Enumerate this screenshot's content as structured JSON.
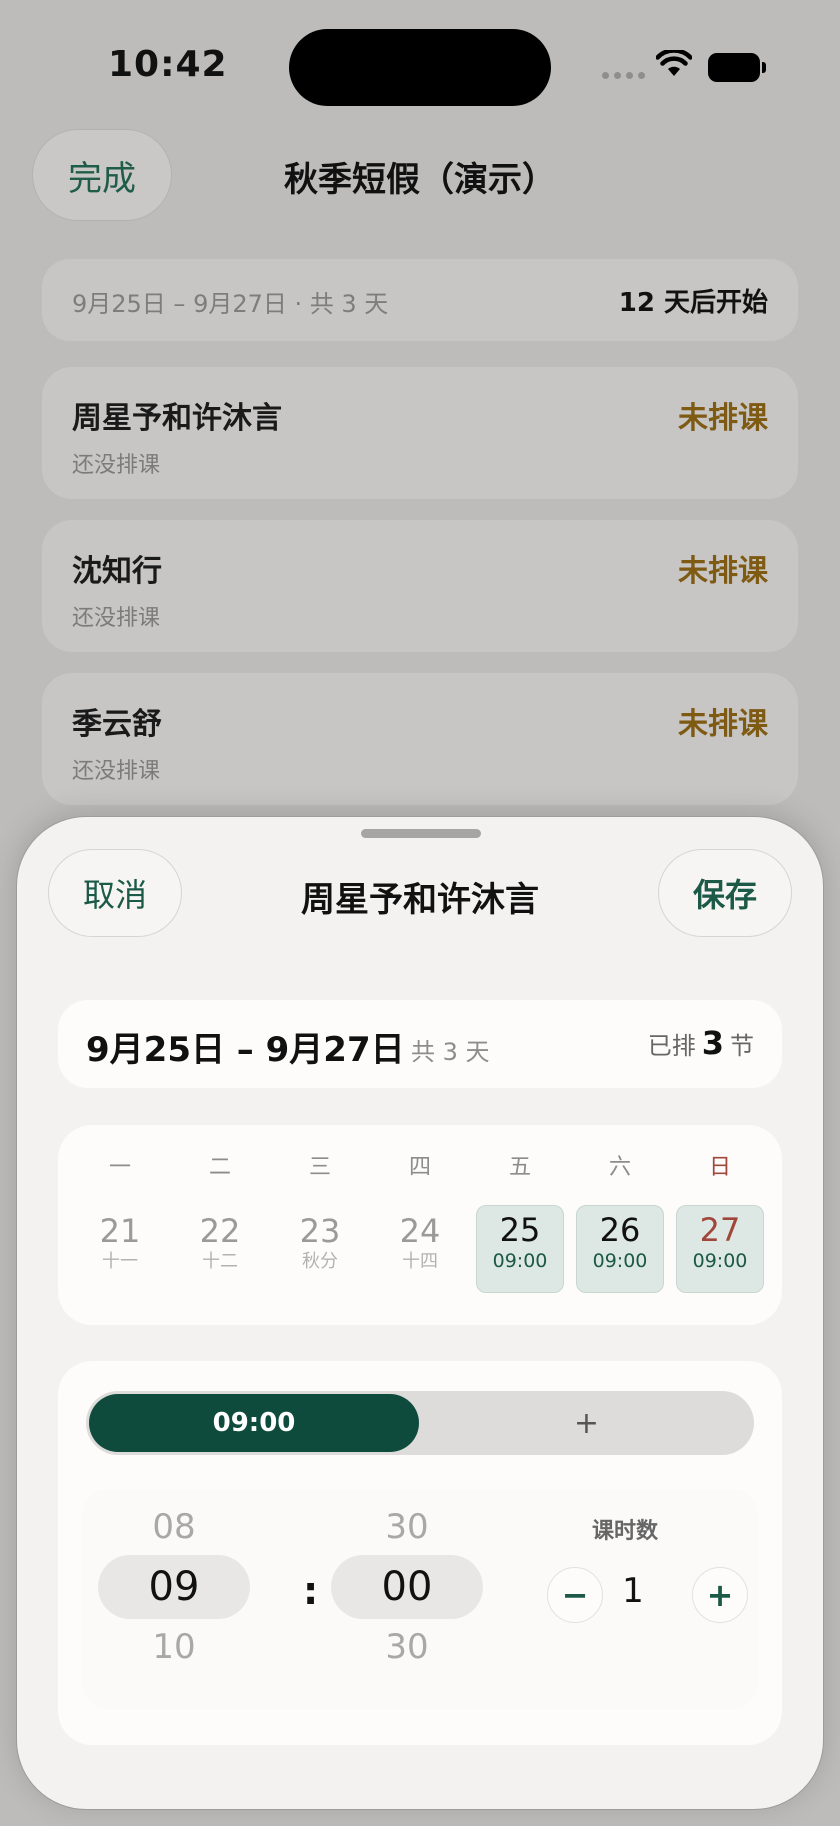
{
  "status_bar": {
    "time": "10:42"
  },
  "nav": {
    "done_label": "完成",
    "title": "秋季短假（演示）"
  },
  "summary": {
    "range": "9月25日 – 9月27日 · 共 3 天",
    "countdown": "12 天后开始"
  },
  "students": [
    {
      "name": "周星予和许沐言",
      "note": "还没排课",
      "state": "未排课"
    },
    {
      "name": "沈知行",
      "note": "还没排课",
      "state": "未排课"
    },
    {
      "name": "季云舒",
      "note": "还没排课",
      "state": "未排课"
    }
  ],
  "sheet": {
    "cancel_label": "取消",
    "title": "周星予和许沐言",
    "save_label": "保存",
    "range": {
      "dates": "9月25日 – 9月27日",
      "days": "共 3 天",
      "scheduled_prefix": "已排",
      "scheduled_count": "3",
      "scheduled_suffix": "节"
    },
    "calendar": {
      "weekdays": [
        "一",
        "二",
        "三",
        "四",
        "五",
        "六",
        "日"
      ],
      "days": [
        {
          "num": "21",
          "label": "十一",
          "selected": false
        },
        {
          "num": "22",
          "label": "十二",
          "selected": false
        },
        {
          "num": "23",
          "label": "秋分",
          "selected": false
        },
        {
          "num": "24",
          "label": "十四",
          "selected": false
        },
        {
          "num": "25",
          "label": "09:00",
          "selected": true
        },
        {
          "num": "26",
          "label": "09:00",
          "selected": true
        },
        {
          "num": "27",
          "label": "09:00",
          "selected": true
        }
      ]
    },
    "slots": {
      "active": "09:00",
      "add": "+"
    },
    "picker": {
      "hour": {
        "prev": "08",
        "current": "09",
        "next": "10"
      },
      "minute": {
        "prev": "30",
        "current": "00",
        "next": "30"
      },
      "separator": ":",
      "lessons_label": "课时数",
      "minus": "−",
      "count": "1",
      "plus": "+"
    }
  },
  "colors": {
    "accent": "#0f4b3d",
    "unscheduled": "#7e5a13",
    "sunday": "#a1463a"
  }
}
